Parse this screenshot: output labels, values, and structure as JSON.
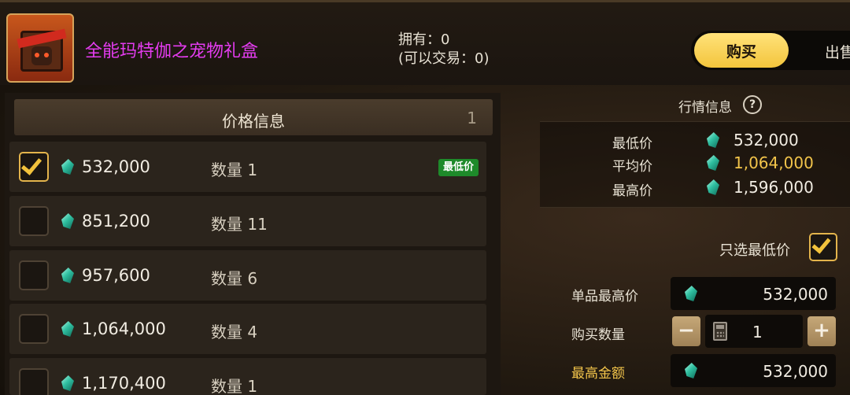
{
  "item": {
    "name": "全能玛特伽之宠物礼盒",
    "icon": "pet-gift-box-icon",
    "owned": "拥有：0",
    "tradable": "(可以交易：0)"
  },
  "tabs": {
    "buy": "购买",
    "sell": "出售"
  },
  "price_list": {
    "title": "价格信息",
    "page": "1",
    "rows": [
      {
        "price": "532,000",
        "qty": "数量 1",
        "checked": true,
        "badge": "最低价"
      },
      {
        "price": "851,200",
        "qty": "数量 11",
        "checked": false
      },
      {
        "price": "957,600",
        "qty": "数量 6",
        "checked": false
      },
      {
        "price": "1,064,000",
        "qty": "数量 4",
        "checked": false
      },
      {
        "price": "1,170,400",
        "qty": "数量 1",
        "checked": false
      }
    ]
  },
  "market": {
    "title": "行情信息",
    "min_label": "最低价",
    "min_value": "532,000",
    "avg_label": "平均价",
    "avg_value": "1,064,000",
    "max_label": "最高价",
    "max_value": "1,596,000"
  },
  "form": {
    "lowest_only_label": "只选最低价",
    "lowest_only_checked": true,
    "max_unit_label": "单品最高价",
    "max_unit_value": "532,000",
    "buy_qty_label": "购买数量",
    "buy_qty_value": "1",
    "minus": "−",
    "plus": "+",
    "max_total_label": "最高金额",
    "max_total_value": "532,000"
  },
  "colors": {
    "item_name": "#e43cf0",
    "accent_gold": "#f2c44a",
    "badge_green": "#1e8a2a",
    "gem": "#2fbfa0"
  }
}
